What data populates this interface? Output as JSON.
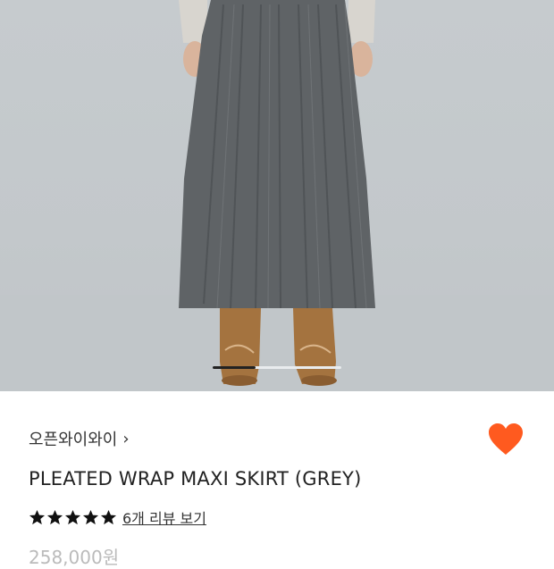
{
  "product": {
    "brand": "오픈와이와이",
    "brand_chevron": "›",
    "title": "PLEATED WRAP MAXI SKIRT (GREY)",
    "rating": 5,
    "review_link": "6개 리뷰 보기",
    "price": "258,000원"
  },
  "gallery": {
    "image_alt": "Model wearing grey pleated maxi skirt with tan boots",
    "progress": 0.33
  },
  "colors": {
    "accent": "#ff5a1f",
    "star": "#111111",
    "skirt": "#5e6265",
    "background": "#c4c9cc"
  },
  "icons": {
    "wishlist": "heart-icon",
    "star": "star-icon",
    "brand_link": "chevron-right-icon"
  }
}
